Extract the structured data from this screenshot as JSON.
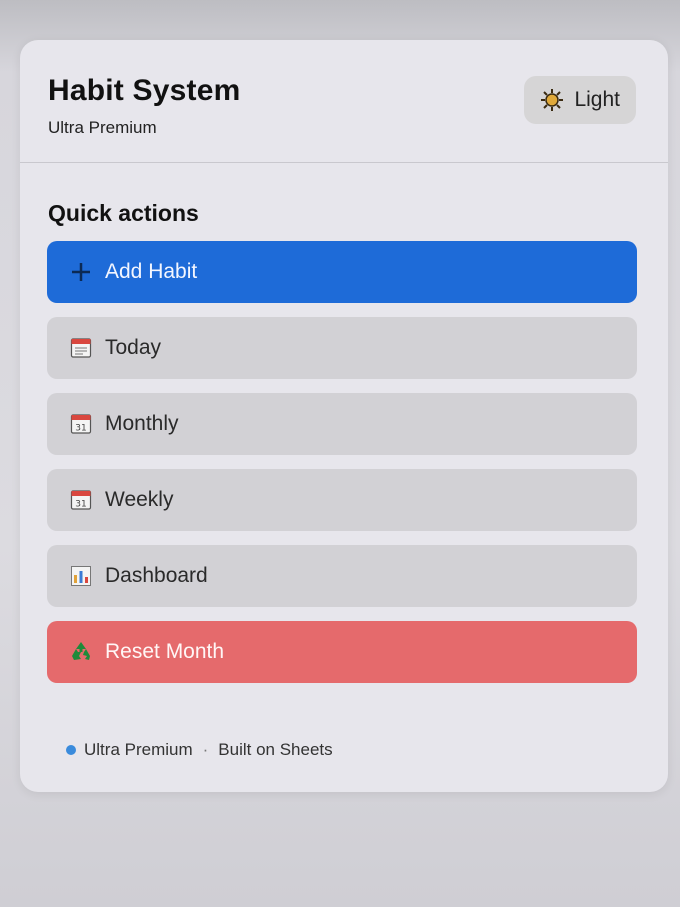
{
  "header": {
    "title": "Habit System",
    "subtitle": "Ultra Premium",
    "theme_toggle": {
      "icon": "sun-icon",
      "label": "Light"
    }
  },
  "quick_actions": {
    "title": "Quick actions",
    "items": [
      {
        "label": "Add Habit",
        "icon": "plus-icon",
        "style": "primary",
        "color": "#1e6bd8"
      },
      {
        "label": "Today",
        "icon": "calendar-icon",
        "style": "default"
      },
      {
        "label": "Monthly",
        "icon": "calendar-icon",
        "style": "default"
      },
      {
        "label": "Weekly",
        "icon": "calendar-icon",
        "style": "default"
      },
      {
        "label": "Dashboard",
        "icon": "bar-chart-icon",
        "style": "default"
      },
      {
        "label": "Reset Month",
        "icon": "recycle-icon",
        "style": "danger",
        "color": "#e56a6c"
      }
    ]
  },
  "footer": {
    "dot_color": "#3a8bdc",
    "brand": "Ultra Premium",
    "separator": "·",
    "note": "Built on Sheets"
  }
}
